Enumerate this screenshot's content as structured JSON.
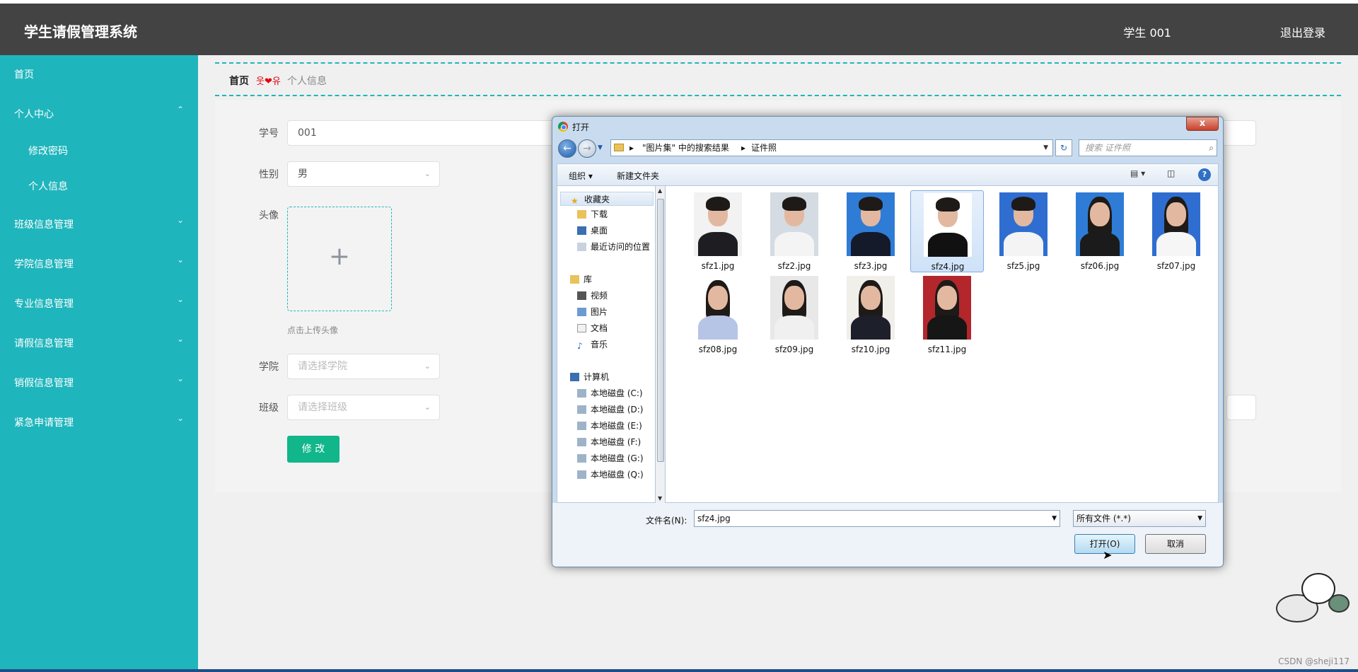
{
  "app": {
    "title": "学生请假管理系统",
    "user": "学生 001",
    "logout": "退出登录"
  },
  "sidebar": {
    "items": [
      {
        "label": "首页",
        "chev": ""
      },
      {
        "label": "个人中心",
        "chev": "⌃"
      },
      {
        "label": "修改密码",
        "chev": ""
      },
      {
        "label": "个人信息",
        "chev": ""
      },
      {
        "label": "班级信息管理",
        "chev": "⌄"
      },
      {
        "label": "学院信息管理",
        "chev": "⌄"
      },
      {
        "label": "专业信息管理",
        "chev": "⌄"
      },
      {
        "label": "请假信息管理",
        "chev": "⌄"
      },
      {
        "label": "销假信息管理",
        "chev": "⌄"
      },
      {
        "label": "紧急申请管理",
        "chev": "⌄"
      }
    ]
  },
  "breadcrumb": {
    "home": "首页",
    "separator": "웃❤유",
    "current": "个人信息"
  },
  "form": {
    "student_no_label": "学号",
    "student_no_value": "001",
    "gender_label": "性别",
    "gender_value": "男",
    "avatar_label": "头像",
    "avatar_plus": "+",
    "avatar_hint": "点击上传头像",
    "college_label": "学院",
    "college_placeholder": "请选择学院",
    "class_label": "班级",
    "class_placeholder": "请选择班级",
    "submit": "修 改"
  },
  "dialog": {
    "title": "打开",
    "close": "x",
    "address": {
      "seg1": "\"图片集\" 中的搜索结果",
      "seg2": "证件照",
      "sep": "▸"
    },
    "search_placeholder": "搜索 证件照",
    "toolbar": {
      "organize": "组织 ▾",
      "new_folder": "新建文件夹",
      "help": "?"
    },
    "nav": {
      "favorites": "收藏夹",
      "fav_items": [
        "下载",
        "桌面",
        "最近访问的位置"
      ],
      "library": "库",
      "lib_items": [
        "视频",
        "图片",
        "文档",
        "音乐"
      ],
      "computer": "计算机",
      "drives": [
        "本地磁盘 (C:)",
        "本地磁盘 (D:)",
        "本地磁盘 (E:)",
        "本地磁盘 (F:)",
        "本地磁盘 (G:)",
        "本地磁盘 (Q:)"
      ]
    },
    "files": [
      "sfz1.jpg",
      "sfz2.jpg",
      "sfz3.jpg",
      "sfz4.jpg",
      "sfz5.jpg",
      "sfz06.jpg",
      "sfz07.jpg",
      "sfz08.jpg",
      "sfz09.jpg",
      "sfz10.jpg",
      "sfz11.jpg"
    ],
    "selected_file": "sfz4.jpg",
    "filename_label": "文件名(N):",
    "filename_value": "sfz4.jpg",
    "filetype_value": "所有文件 (*.*)",
    "open_button": "打开(O)",
    "cancel_button": "取消"
  },
  "watermark": "CSDN @sheji117",
  "colors": {
    "sidebar": "#1fb5bc",
    "header": "#434343",
    "button": "#11b68a"
  }
}
